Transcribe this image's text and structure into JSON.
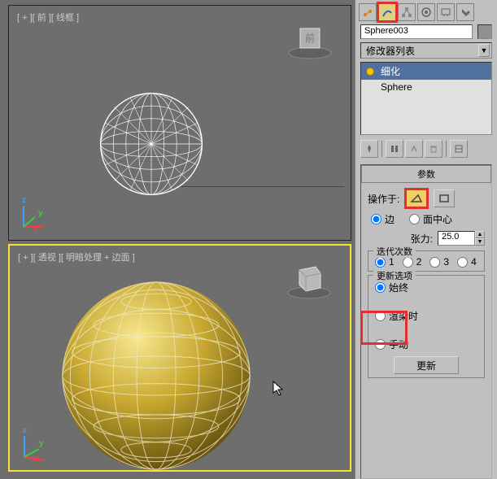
{
  "viewport": {
    "top_label": "[ + ][ 前 ][ 线框 ]",
    "bottom_label": "[ + ][ 透视 ][ 明暗处理 + 边面 ]",
    "cube_face": "前"
  },
  "axes": {
    "x": "x",
    "y": "y",
    "z": "z"
  },
  "object_name": "Sphere003",
  "modlist_label": "修改器列表",
  "stack": {
    "item0": "细化",
    "item1": "Sphere"
  },
  "params": {
    "title": "参数",
    "operate_on": "操作于:",
    "edge": "边",
    "face_center": "面中心",
    "tension": "张力:",
    "tension_val": "25.0",
    "iterations": "迭代次数",
    "it1": "1",
    "it2": "2",
    "it3": "3",
    "it4": "4",
    "update_opts": "更新选项",
    "always": "始终",
    "on_render": "渲染时",
    "manual": "手动",
    "update_btn": "更新"
  }
}
